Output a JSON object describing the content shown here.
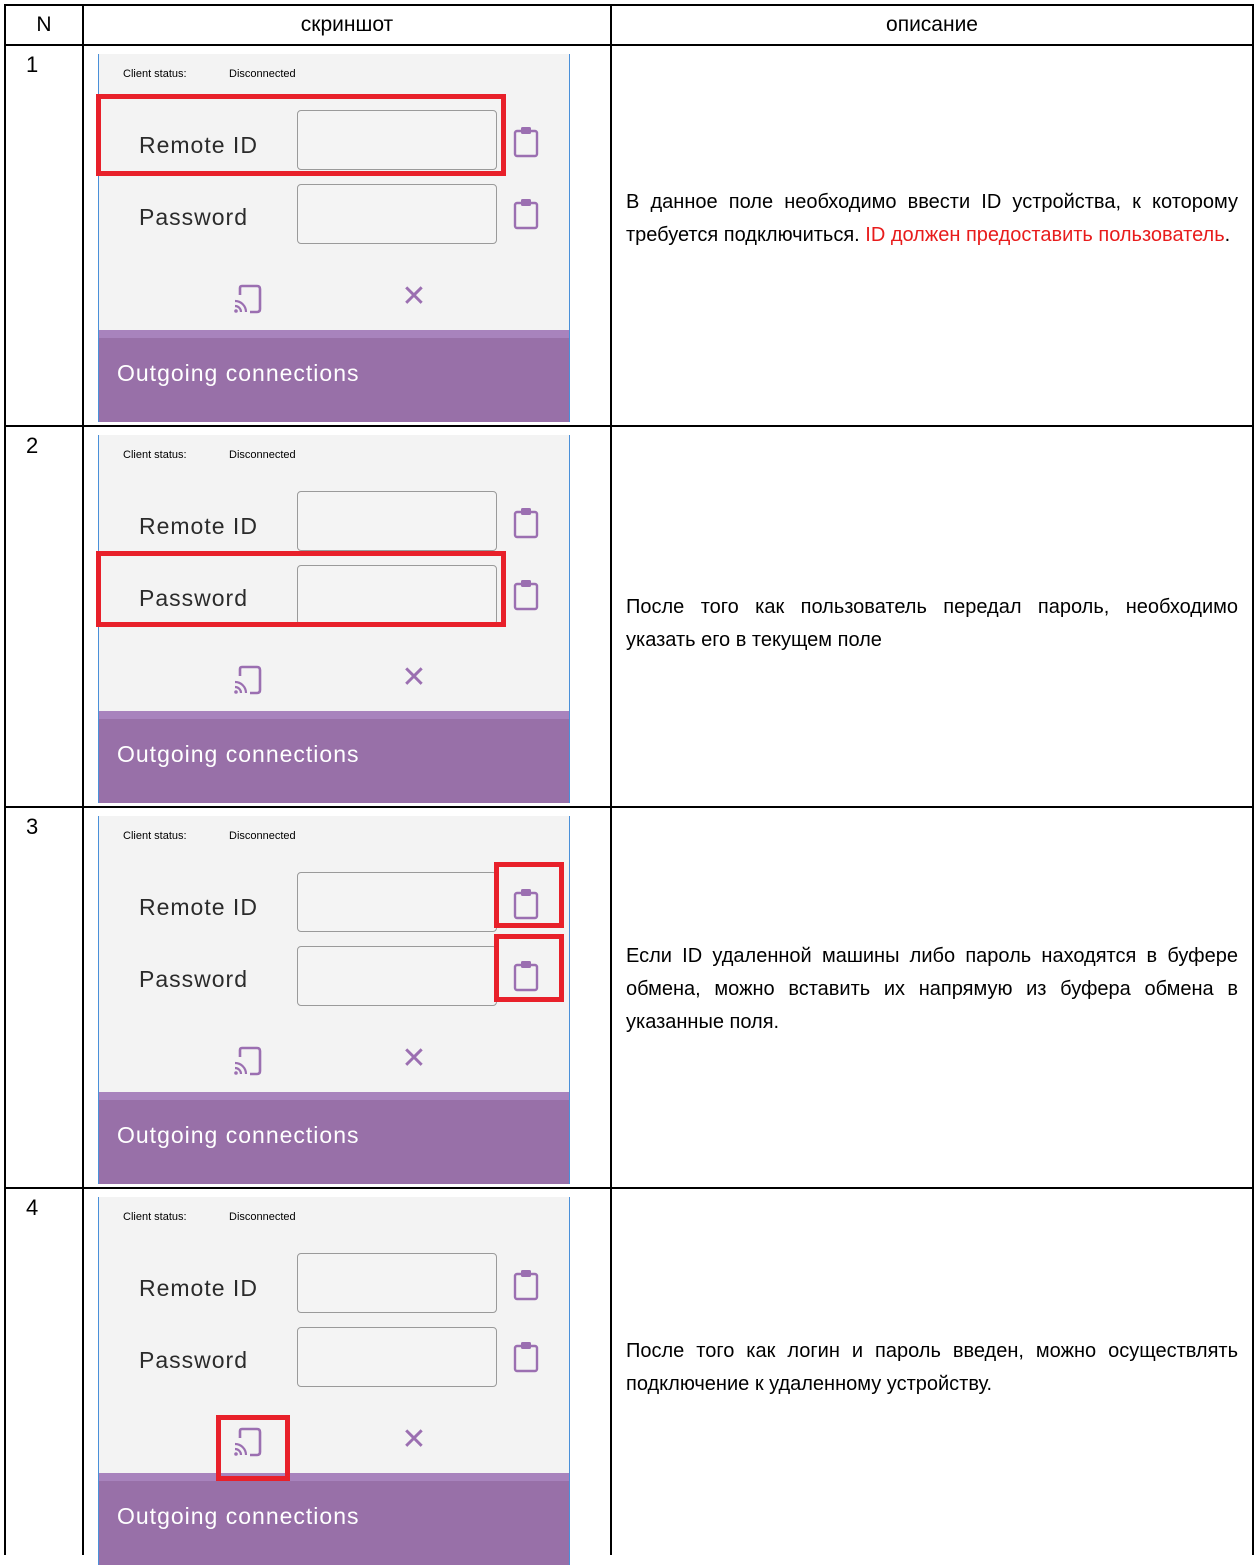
{
  "table": {
    "headers": {
      "number": "N",
      "screenshot": "скриншот",
      "description": "описание"
    }
  },
  "panel": {
    "client_status_label": "Client status:",
    "client_status_value": "Disconnected",
    "remote_id_label": "Remote ID",
    "password_label": "Password",
    "footer_label": "Outgoing connections",
    "icons": {
      "clipboard": "clipboard-paste-icon",
      "connect": "cast-connect-icon",
      "close": "close-icon"
    },
    "colors": {
      "accent": "#9b6fb1",
      "footer": "#9870a8",
      "highlight": "#e8202a",
      "panel_bg": "#f3f3f3"
    }
  },
  "rows": [
    {
      "number": "1",
      "highlight": "remote-id",
      "description": "В данное поле необходимо ввести ID устройства, к которому требуется подключиться.",
      "description_red": "ID должен предоставить пользователь",
      "description_tail": "."
    },
    {
      "number": "2",
      "highlight": "password",
      "description": "После того как пользователь передал пароль, необходимо указать его в текущем поле",
      "description_red": "",
      "description_tail": ""
    },
    {
      "number": "3",
      "highlight": "clipboard-buttons",
      "description": "Если ID удаленной машины либо пароль находятся в буфере обмена, можно вставить их напрямую из буфера обмена в указанные поля.",
      "description_red": "",
      "description_tail": ""
    },
    {
      "number": "4",
      "highlight": "connect-button",
      "description": "После того как логин и пароль введен, можно осуществлять подключение к удаленному устройству.",
      "description_red": "",
      "description_tail": ""
    }
  ]
}
